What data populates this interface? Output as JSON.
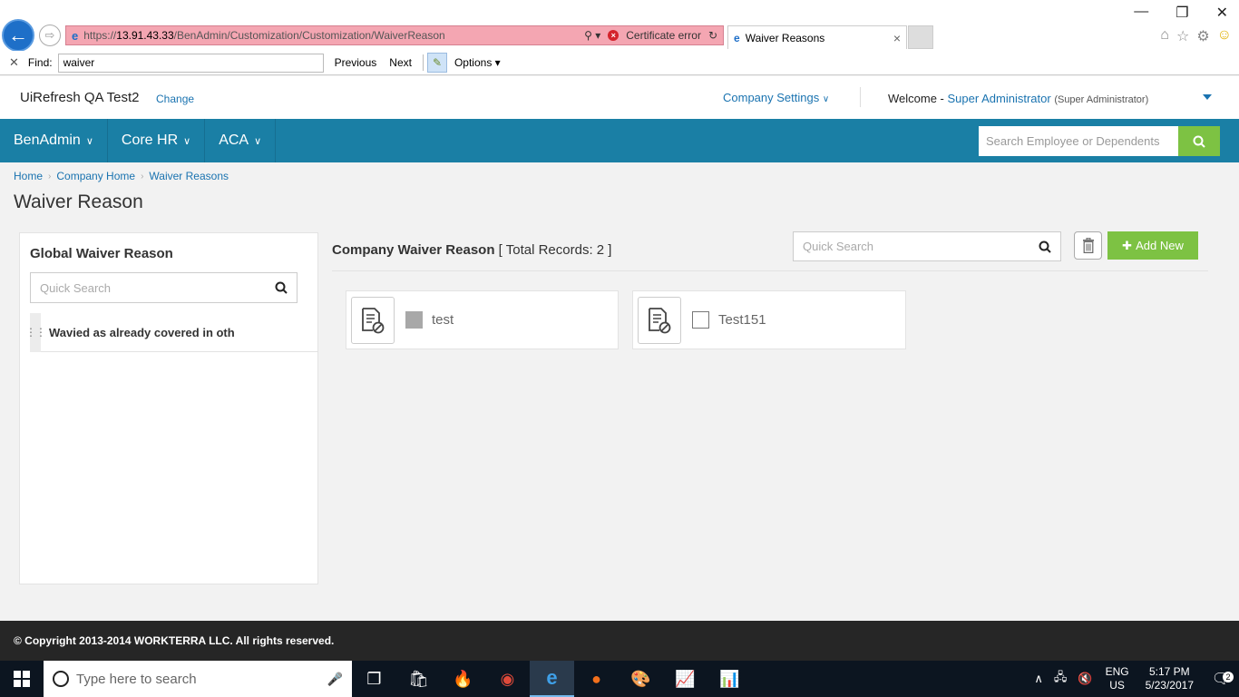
{
  "browser": {
    "url_proto": "https://",
    "url_host": "13.91.43.33",
    "url_path": "/BenAdmin/Customization/Customization/WaiverReason",
    "cert_error": "Certificate error",
    "tab_title": "Waiver Reasons"
  },
  "findbar": {
    "label": "Find:",
    "value": "waiver",
    "previous": "Previous",
    "next": "Next",
    "options": "Options"
  },
  "header": {
    "company": "UiRefresh QA Test2",
    "change": "Change",
    "company_settings": "Company Settings",
    "welcome": "Welcome -",
    "user_name": "Super Administrator",
    "user_role": "(Super Administrator)"
  },
  "nav": {
    "items": [
      {
        "label": "BenAdmin"
      },
      {
        "label": "Core HR"
      },
      {
        "label": "ACA"
      }
    ],
    "search_placeholder": "Search Employee or Dependents"
  },
  "breadcrumb": [
    "Home",
    "Company Home",
    "Waiver Reasons"
  ],
  "page_title": "Waiver Reason",
  "global_panel": {
    "title": "Global Waiver Reason",
    "search_placeholder": "Quick Search",
    "items": [
      {
        "label": "Wavied as already covered in other"
      }
    ]
  },
  "company_panel": {
    "title": "Company Waiver Reason",
    "records": "[ Total Records: 2 ]",
    "search_placeholder": "Quick Search",
    "add_label": "Add New",
    "cards": [
      {
        "label": "test",
        "checked": true
      },
      {
        "label": "Test151",
        "checked": false
      }
    ]
  },
  "footer": {
    "copyright": "© Copyright 2013-2014 WORKTERRA LLC. All rights reserved."
  },
  "taskbar": {
    "search_placeholder": "Type here to search",
    "lang_top": "ENG",
    "lang_bottom": "US",
    "time": "5:17 PM",
    "date": "5/23/2017",
    "notif_count": "2"
  },
  "colors": {
    "nav_bg": "#1a7fa5",
    "accent_green": "#7dc243",
    "link_blue": "#1a73b0"
  }
}
